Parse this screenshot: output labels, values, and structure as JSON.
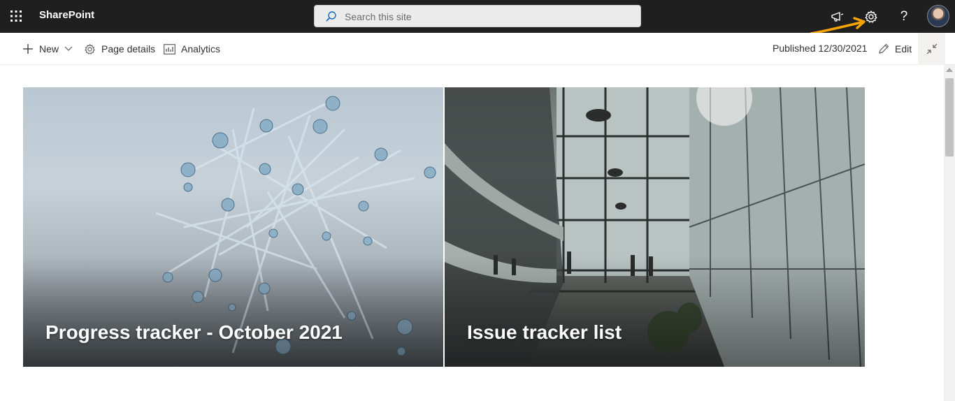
{
  "suite_bar": {
    "app_name": "SharePoint",
    "search_placeholder": "Search this site",
    "icons": [
      "waffle-icon",
      "search-icon",
      "megaphone-icon",
      "gear-icon",
      "help-icon",
      "avatar"
    ],
    "help_glyph": "?",
    "annotation_color": "#f5a300"
  },
  "command_bar": {
    "new_label": "New",
    "page_details_label": "Page details",
    "analytics_label": "Analytics",
    "published_text": "Published 12/30/2021",
    "edit_label": "Edit"
  },
  "hero": {
    "tiles": [
      {
        "title": "Progress tracker - October 2021",
        "image": "molecular-network"
      },
      {
        "title": "Issue tracker list",
        "image": "office-atrium"
      }
    ]
  },
  "colors": {
    "suite_bar_bg": "#1f1f1f",
    "accent": "#0078d4"
  }
}
